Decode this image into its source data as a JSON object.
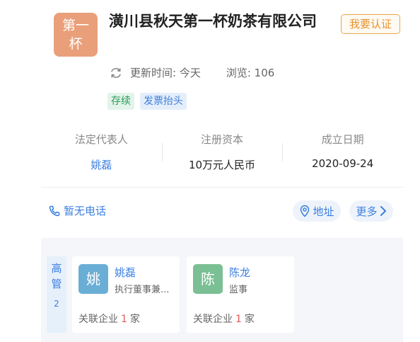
{
  "header": {
    "logo_line1": "第一",
    "logo_line2": "杯",
    "company_name": "潢川县秋天第一杯奶茶有限公司",
    "claim_label": "我要认证",
    "updated_label": "更新时间: 今天",
    "views_label": "浏览: 106",
    "tags": [
      "存续",
      "发票抬头"
    ]
  },
  "info": {
    "legal_rep_label": "法定代表人",
    "legal_rep_value": "姚磊",
    "capital_label": "注册资本",
    "capital_value": "10万元人民币",
    "founded_label": "成立日期",
    "founded_value": "2020-09-24"
  },
  "contact": {
    "phone_label": "暂无电话",
    "address_label": "地址",
    "more_label": "更多"
  },
  "executives": {
    "side_label_1": "高",
    "side_label_2": "管",
    "count": "2",
    "people": [
      {
        "avatar": "姚",
        "name": "姚磊",
        "role": "执行董事兼...",
        "related_prefix": "关联企业",
        "related_count": "1",
        "related_suffix": "家"
      },
      {
        "avatar": "陈",
        "name": "陈龙",
        "role": "监事",
        "related_prefix": "关联企业",
        "related_count": "1",
        "related_suffix": "家"
      }
    ]
  },
  "colors": {
    "accent_blue": "#3b7fe0",
    "logo_orange": "#e9a07a",
    "claim_orange": "#e8922e",
    "status_green": "#2a9d5c",
    "count_red": "#e45757"
  },
  "icons": [
    "refresh-icon",
    "phone-icon",
    "location-pin-icon",
    "chevron-right-icon"
  ]
}
